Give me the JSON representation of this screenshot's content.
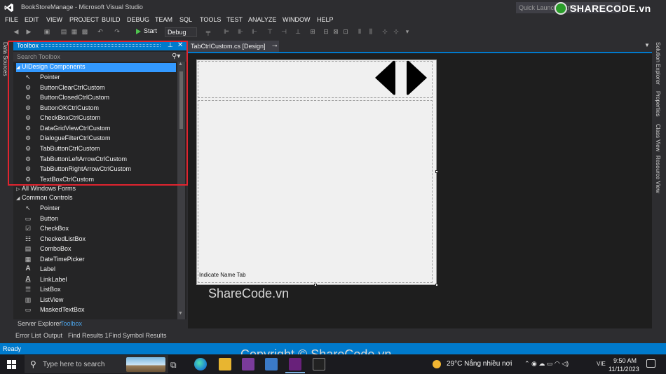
{
  "window": {
    "title": "BookStoreManage - Microsoft Visual Studio",
    "quick_launch": "Quick Launch (Ctrl+Q)",
    "watermark_logo": "SHARECODE.vn"
  },
  "menu": [
    "FILE",
    "EDIT",
    "VIEW",
    "PROJECT",
    "BUILD",
    "DEBUG",
    "TEAM",
    "SQL",
    "TOOLS",
    "TEST",
    "ANALYZE",
    "WINDOW",
    "HELP"
  ],
  "toolbar": {
    "start_label": "Start",
    "config_value": "Debug"
  },
  "left_strip": {
    "label": "Data Sources"
  },
  "toolbox": {
    "title": "Toolbox",
    "search_placeholder": "Search Toolbox",
    "categories": [
      {
        "name": "UIDesign Components",
        "expanded": true,
        "selected": true,
        "items": [
          {
            "label": "Pointer",
            "icon": "pointer-icon"
          },
          {
            "label": "ButtonClearCtrlCustom",
            "icon": "component-icon"
          },
          {
            "label": "ButtonClosedCtrlCustom",
            "icon": "component-icon"
          },
          {
            "label": "ButtonOKCtrlCustom",
            "icon": "component-icon"
          },
          {
            "label": "CheckBoxCtrlCustom",
            "icon": "component-icon"
          },
          {
            "label": "DataGridViewCtrlCustom",
            "icon": "component-icon"
          },
          {
            "label": "DialogueFilterCtrlCustom",
            "icon": "component-icon"
          },
          {
            "label": "TabButtonCtrlCustom",
            "icon": "component-icon"
          },
          {
            "label": "TabButtonLeftArrowCtrlCustom",
            "icon": "component-icon"
          },
          {
            "label": "TabButtonRightArrowCtrlCustom",
            "icon": "component-icon"
          },
          {
            "label": "TextBoxCtrlCustom",
            "icon": "component-icon"
          }
        ]
      },
      {
        "name": "All Windows Forms",
        "expanded": false,
        "items": []
      },
      {
        "name": "Common Controls",
        "expanded": true,
        "items": [
          {
            "label": "Pointer",
            "icon": "pointer-icon"
          },
          {
            "label": "Button",
            "icon": "button-icon"
          },
          {
            "label": "CheckBox",
            "icon": "checkbox-icon"
          },
          {
            "label": "CheckedListBox",
            "icon": "checkedlistbox-icon"
          },
          {
            "label": "ComboBox",
            "icon": "combobox-icon"
          },
          {
            "label": "DateTimePicker",
            "icon": "datetimepicker-icon"
          },
          {
            "label": "Label",
            "icon": "label-icon"
          },
          {
            "label": "LinkLabel",
            "icon": "linklabel-icon"
          },
          {
            "label": "ListBox",
            "icon": "listbox-icon"
          },
          {
            "label": "ListView",
            "icon": "listview-icon"
          },
          {
            "label": "MaskedTextBox",
            "icon": "maskedtextbox-icon"
          }
        ]
      }
    ],
    "bottom_tabs": [
      "Server Explorer",
      "Toolbox"
    ],
    "active_bottom_tab": "Toolbox"
  },
  "document": {
    "tab_label": "TabCtrlCustom.cs [Design]",
    "form_label": "Indicate Name Tab",
    "watermark": "ShareCode.vn"
  },
  "right_strip": [
    "Solution Explorer",
    "Properties",
    "Class View",
    "Resource View"
  ],
  "output_tabs": [
    "Error List",
    "Output",
    "Find Results 1",
    "Find Symbol Results"
  ],
  "status": {
    "text": "Ready",
    "watermark": "Copyright © ShareCode.vn"
  },
  "taskbar": {
    "search_placeholder": "Type here to search",
    "weather": "29°C  Nắng nhiều nơi",
    "language": "VIE",
    "time": "9:50 AM",
    "date": "11/11/2023"
  },
  "colors": {
    "accent": "#007acc",
    "selection": "#3399ff",
    "highlight_box": "#e0242f",
    "background": "#2d2d30"
  }
}
